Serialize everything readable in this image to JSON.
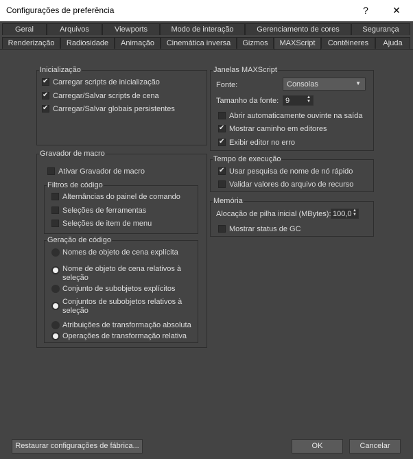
{
  "window": {
    "title": "Configurações de preferência",
    "help": "?",
    "close": "✕"
  },
  "tabs_top": [
    "Geral",
    "Arquivos",
    "Viewports",
    "Modo de interação",
    "Gerenciamento de cores",
    "Segurança"
  ],
  "tabs_bottom": [
    "Renderização",
    "Radiosidade",
    "Animação",
    "Cinemática inversa",
    "Gizmos",
    "MAXScript",
    "Contêineres",
    "Ajuda"
  ],
  "active_tab": "MAXScript",
  "startup": {
    "title": "Inicialização",
    "items": [
      {
        "label": "Carregar scripts de inicialização",
        "checked": true
      },
      {
        "label": "Carregar/Salvar scripts de cena",
        "checked": true
      },
      {
        "label": "Carregar/Salvar globais persistentes",
        "checked": true
      }
    ]
  },
  "macro": {
    "title": "Gravador de macro",
    "enable": {
      "label": "Ativar Gravador de macro",
      "checked": false
    },
    "filters": {
      "title": "Filtros de código",
      "items": [
        {
          "label": "Alternâncias do painel de comando",
          "checked": false
        },
        {
          "label": "Seleções de ferramentas",
          "checked": false
        },
        {
          "label": "Seleções de item de menu",
          "checked": false
        }
      ]
    },
    "generation": {
      "title": "Geração de código",
      "items": [
        {
          "label": "Nomes de objeto de cena explícita",
          "checked": false
        },
        {
          "label": "Nome de objeto de cena relativos à seleção",
          "line1": "Nome de objeto de cena relativos à",
          "line2": "seleção",
          "checked": true
        },
        {
          "label": "Conjunto de subobjetos explícitos",
          "checked": false
        },
        {
          "label": "Conjuntos de subobjetos relativos à seleção",
          "line1": "Conjuntos de subobjetos relativos à",
          "line2": "seleção",
          "checked": true
        },
        {
          "label": "Atribuições de transformação absoluta",
          "checked": false
        },
        {
          "label": "Operações de transformação relativa",
          "checked": true
        }
      ]
    }
  },
  "windows": {
    "title": "Janelas MAXScript",
    "font_label": "Fonte:",
    "font_value": "Consolas",
    "size_label": "Tamanho da fonte:",
    "size_value": "9",
    "items": [
      {
        "label": "Abrir automaticamente ouvinte na saída",
        "checked": false
      },
      {
        "label": "Mostrar caminho em editores",
        "checked": true
      },
      {
        "label": "Exibir editor no erro",
        "checked": true
      }
    ]
  },
  "runtime": {
    "title": "Tempo de execução",
    "items": [
      {
        "label": "Usar pesquisa de nome de nó rápido",
        "checked": true
      },
      {
        "label": "Validar valores do arquivo de recurso",
        "checked": false
      }
    ]
  },
  "memory": {
    "title": "Memória",
    "stack_label": "Alocação de pilha inicial (MBytes):",
    "stack_value": "100,0",
    "gc": {
      "label": "Mostrar status de GC",
      "checked": false
    }
  },
  "footer": {
    "restore": "Restaurar configurações de fábrica...",
    "ok": "OK",
    "cancel": "Cancelar"
  }
}
